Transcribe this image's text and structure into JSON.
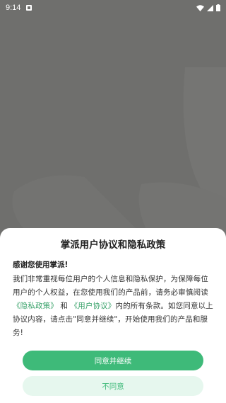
{
  "status_bar": {
    "time": "9:14",
    "notification_icon": "notification-a-icon",
    "wifi_icon": "wifi-icon",
    "signal_icon": "signal-icon",
    "battery_icon": "battery-icon"
  },
  "colors": {
    "overlay_background": "#6f6f6d",
    "accent_green": "#3eba79",
    "link_green": "#3aa36b",
    "secondary_button_bg": "#e6f7ee"
  },
  "dialog": {
    "title": "掌派用户协议和隐私政策",
    "greeting": "感谢您使用掌派!",
    "body_part1": "我们非常重视每位用户的个人信息和隐私保护，为保障每位用户的个人权益，在您使用我们的产品前，请务必审慎阅读",
    "privacy_link": "《隐私政策》",
    "and_text": "和",
    "agreement_link": "《用户协议》",
    "body_part2": "内的所有条款。如您同意以上协议内容，请点击\"同意并继续\"，开始使用我们的产品和服务!",
    "agree_button": "同意并继续",
    "disagree_button": "不同意"
  }
}
